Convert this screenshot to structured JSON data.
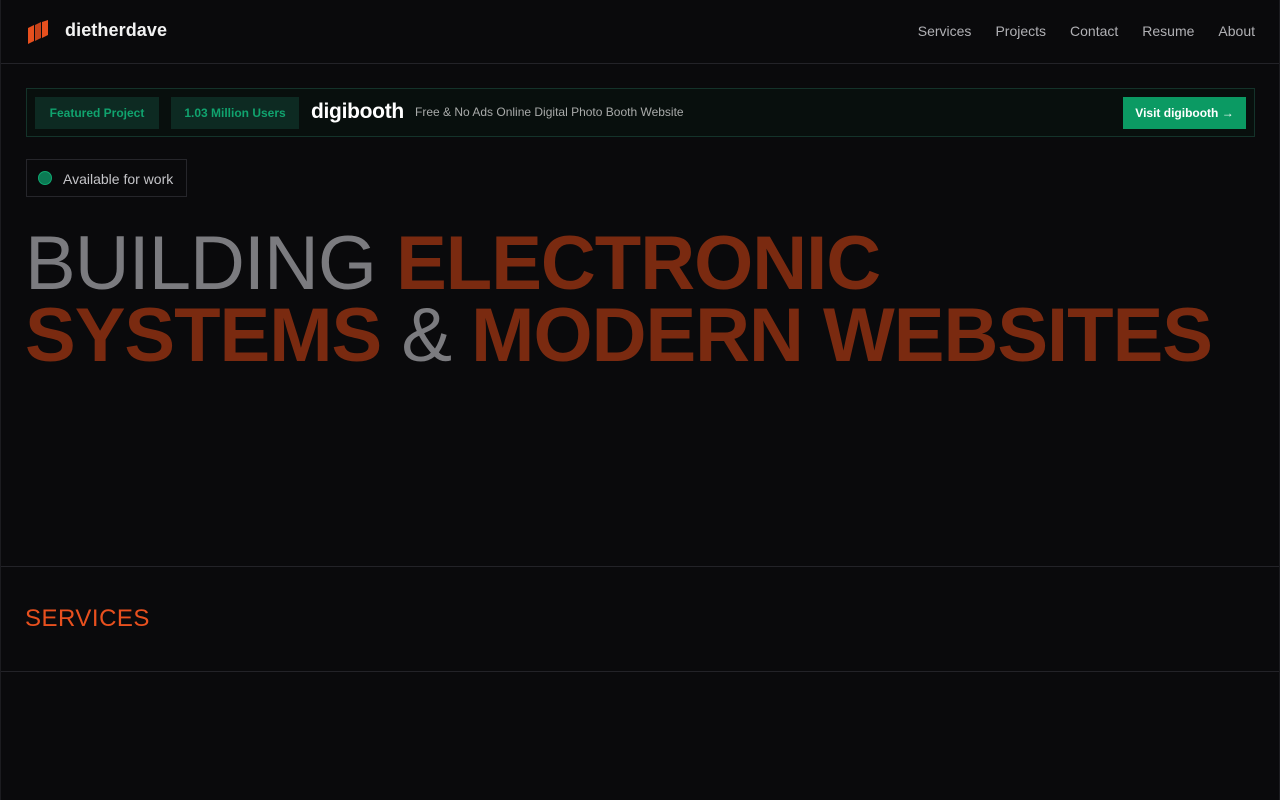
{
  "header": {
    "brand": "dietherdave",
    "nav": [
      "Services",
      "Projects",
      "Contact",
      "Resume",
      "About"
    ]
  },
  "banner": {
    "featured_label": "Featured Project",
    "users_label": "1.03 Million Users",
    "project_name": "digibooth",
    "project_description": "Free & No Ads Online Digital Photo Booth Website",
    "visit_button": "Visit digibooth →"
  },
  "status": {
    "available_text": "Available for work"
  },
  "hero": {
    "word1": "BUILDING",
    "word2": "ELECTRONIC",
    "word3": "SYSTEMS",
    "amp": "&",
    "word4": "MODERN WEBSITES"
  },
  "sections": {
    "services_title": "SERVICES"
  },
  "colors": {
    "background": "#0a0a0c",
    "accent_orange": "#e8501e",
    "hero_accent": "#7a2a10",
    "green": "#0b9a63"
  },
  "icons": {
    "logo": "brand-logo-icon",
    "status": "status-dot-icon"
  }
}
